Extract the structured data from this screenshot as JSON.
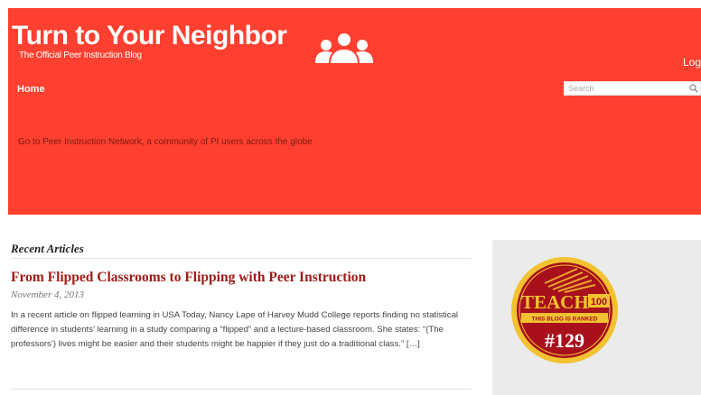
{
  "header": {
    "site_title": "Turn to Your Neighbor",
    "tagline": "The Official Peer Instruction Blog",
    "login_label": "Log",
    "nav": {
      "home_label": "Home"
    },
    "search": {
      "placeholder": "Search"
    },
    "network_link": "Go to Peer Instruction Network, a community of PI users across the globe"
  },
  "main": {
    "section_heading": "Recent Articles",
    "article": {
      "title": "From Flipped Classrooms to Flipping with Peer Instruction",
      "date": "November 4, 2013",
      "excerpt": "In a recent article on flipped learning in USA Today, Nancy Lape of Harvey Mudd College reports finding no statistical difference in students’ learning in a study comparing a “flipped” and a lecture-based classroom.  She states: “(The professors’) lives might be easier and their students might be happier if they just do a traditional class.”",
      "read_more": "[…]"
    }
  },
  "sidebar": {
    "badge": {
      "teach_text": "TEACH",
      "tag_text": "100",
      "ribbon_text": "THIS BLOG IS RANKED",
      "rank": "#129"
    }
  },
  "colors": {
    "header_bg": "#ff3f2f",
    "title_link": "#9e1b16",
    "badge_red": "#a8101c",
    "badge_gold": "#f2c230"
  },
  "icons": {
    "people": "people-group-icon",
    "search": "search-icon"
  }
}
